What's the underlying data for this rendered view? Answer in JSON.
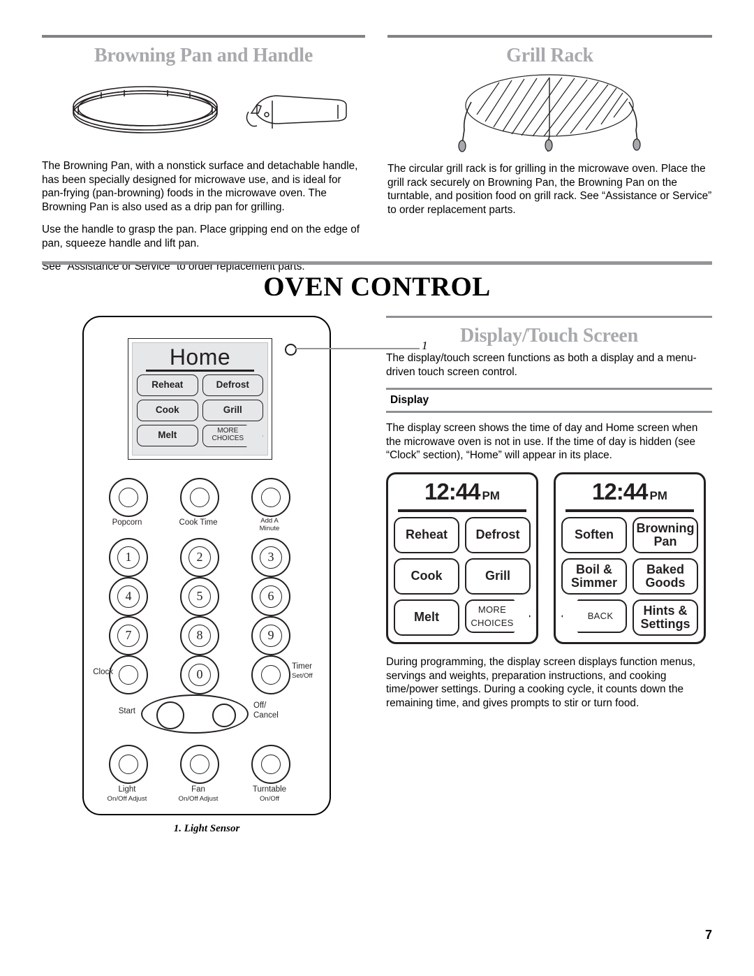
{
  "top": {
    "left_section": {
      "title": "Browning Pan and Handle",
      "figure": "browning-pan-and-handle-illustration",
      "paragraphs": [
        "The Browning Pan, with a nonstick surface and detachable handle, has been specially designed for microwave use, and is ideal for pan-frying (pan-browning) foods in the microwave oven. The Browning Pan is also used as a drip pan for grilling.",
        "Use the handle to grasp the pan. Place gripping end on the edge of pan, squeeze handle and lift pan.",
        "See “Assistance or Service” to order replacement parts."
      ]
    },
    "right_section": {
      "title": "Grill Rack",
      "figure": "grill-rack-illustration",
      "paragraphs": [
        "The circular grill rack is for grilling in the microwave oven. Place the grill rack securely on Browning Pan, the Browning Pan on the turntable, and position food on grill rack. See “Assistance or Service” to order replacement parts."
      ]
    }
  },
  "oven_control": {
    "heading": "OVEN CONTROL"
  },
  "control_panel": {
    "screen_title": "Home",
    "screen_keys": [
      "Reheat",
      "Defrost",
      "Cook",
      "Grill",
      "Melt"
    ],
    "more_choices_line1": "MORE",
    "more_choices_line2": "CHOICES",
    "callout_number": "1",
    "caption": "1. Light Sensor",
    "top_buttons": [
      {
        "label": "Popcorn",
        "sub": ""
      },
      {
        "label": "Cook Time",
        "sub": ""
      },
      {
        "label": "Add A",
        "sub": "Minute"
      }
    ],
    "digits": [
      "1",
      "2",
      "3",
      "4",
      "5",
      "6",
      "7",
      "8",
      "9",
      "0"
    ],
    "clock_label": "Clock",
    "timer_label": "Timer",
    "timer_sub": "Set/Off",
    "start_label": "Start",
    "cancel_label": "Off/",
    "cancel_label2": "Cancel",
    "bottom_buttons": [
      {
        "label": "Light",
        "sub": "On/Off Adjust"
      },
      {
        "label": "Fan",
        "sub": "On/Off Adjust"
      },
      {
        "label": "Turntable",
        "sub": "On/Off"
      }
    ]
  },
  "display_section": {
    "title": "Display/Touch Screen",
    "intro": "The display/touch screen functions as both a display and a menu-driven touch screen control.",
    "sub_head": "Display",
    "paragraph1": "The display screen shows the time of day and Home screen when the microwave oven is not in use. If the time of day is hidden (see “Clock” section), “Home” will appear in its place.",
    "paragraph2": "During programming, the display screen displays function menus, servings and weights, preparation instructions, and cooking time/power settings. During a cooking cycle, it counts down the remaining time, and gives prompts to stir or turn food.",
    "screen_one": {
      "time": "12:44",
      "meridiem": "PM",
      "keys": [
        "Reheat",
        "Defrost",
        "Cook",
        "Grill",
        "Melt"
      ],
      "more_line1": "MORE",
      "more_line2": "CHOICES"
    },
    "screen_two": {
      "time": "12:44",
      "meridiem": "PM",
      "keys": [
        "Soften",
        "Browning Pan",
        "Boil & Simmer",
        "Baked Goods",
        "Hints & Settings"
      ],
      "back_label": "BACK"
    }
  },
  "footer": {
    "page_number": "7"
  }
}
